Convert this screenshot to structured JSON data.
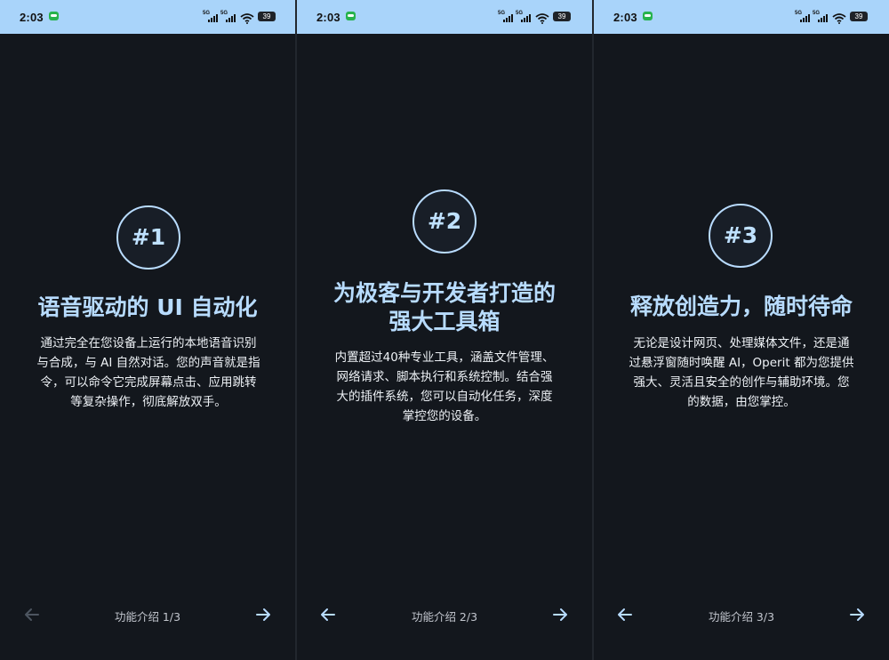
{
  "status_bar": {
    "time": "2:03",
    "signal_1": "5G",
    "signal_2": "5G",
    "battery": "39"
  },
  "screens": [
    {
      "badge": "#1",
      "title_lines": [
        "语音驱动的 UI 自动化"
      ],
      "description_lines": [
        "通过完全在您设备上运行的本地语音识别",
        "与合成，与 AI 自然对话。您的声音就是指",
        "令，可以命令它完成屏幕点击、应用跳转",
        "等复杂操作，彻底解放双手。"
      ],
      "page_label": "功能介绍 1/3",
      "prev_enabled": false,
      "next_enabled": true
    },
    {
      "badge": "#2",
      "title_lines": [
        "为极客与开发者打造的",
        "强大工具箱"
      ],
      "description_lines": [
        "内置超过40种专业工具，涵盖文件管理、",
        "网络请求、脚本执行和系统控制。结合强",
        "大的插件系统，您可以自动化任务，深度",
        "掌控您的设备。"
      ],
      "page_label": "功能介绍 2/3",
      "prev_enabled": true,
      "next_enabled": true
    },
    {
      "badge": "#3",
      "title_lines": [
        "释放创造力，随时待命"
      ],
      "description_lines": [
        "无论是设计网页、处理媒体文件，还是通",
        "过悬浮窗随时唤醒 AI，Operit 都为您提供",
        "强大、灵活且安全的创作与辅助环境。您",
        "的数据，由您掌控。"
      ],
      "page_label": "功能介绍 3/3",
      "prev_enabled": true,
      "next_enabled": true
    }
  ],
  "icons": {
    "prev": "arrow-left-icon",
    "next": "arrow-right-icon",
    "chat": "chat-notification-icon",
    "wifi": "wifi-icon",
    "signal": "signal-icon",
    "battery": "battery-icon"
  },
  "colors": {
    "status_bar": "#a9d4fa",
    "background": "#13171d",
    "accent": "#b8dcff",
    "text": "#eef2f6",
    "disabled_arrow": "#4d5560"
  }
}
